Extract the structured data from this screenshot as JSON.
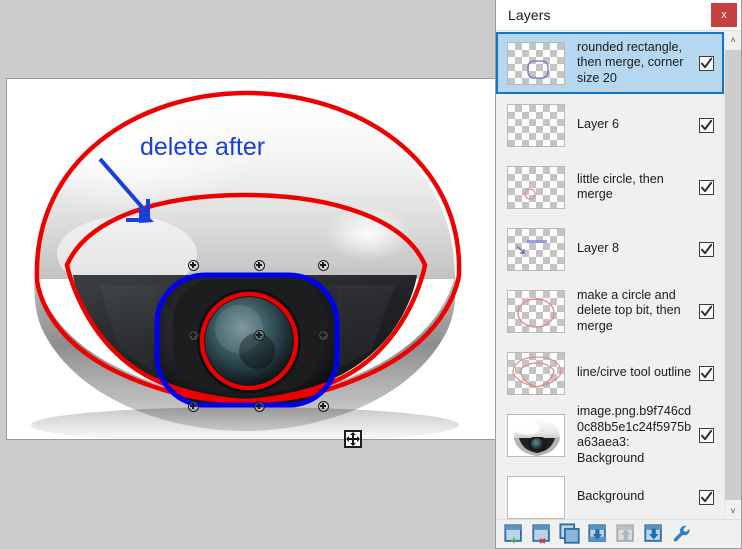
{
  "window": {
    "title": "Layers",
    "close_label": "x",
    "close_icon": "close-icon"
  },
  "layers": {
    "checkbox_icon": "checkmark-icon",
    "items": [
      {
        "name": "rounded rectangle, then merge, corner size 20",
        "visible": true,
        "selected": true,
        "thumb": "checker-rounded-rect"
      },
      {
        "name": "Layer 6",
        "visible": true,
        "selected": false,
        "thumb": "checker-empty"
      },
      {
        "name": "little circle, then merge",
        "visible": true,
        "selected": false,
        "thumb": "checker-little-circle"
      },
      {
        "name": "Layer 8",
        "visible": true,
        "selected": false,
        "thumb": "checker-arrow-text"
      },
      {
        "name": "make a circle and delete top bit, then merge",
        "visible": true,
        "selected": false,
        "thumb": "checker-circle"
      },
      {
        "name": "line/cirve tool outline",
        "visible": true,
        "selected": false,
        "thumb": "checker-dome-outline"
      },
      {
        "name": "image.png.b9f746cd0c88b5e1c24f5975ba63aea3: Background",
        "visible": true,
        "selected": false,
        "thumb": "camera-photo"
      },
      {
        "name": "Background",
        "visible": true,
        "selected": false,
        "thumb": "white-empty"
      }
    ]
  },
  "scrollbar": {
    "up_arrow": "˄",
    "down_arrow": "˅"
  },
  "toolbar": {
    "buttons": [
      {
        "label": "New Layer",
        "icon": "new-layer-icon"
      },
      {
        "label": "Delete Layer",
        "icon": "delete-layer-icon"
      },
      {
        "label": "Duplicate Layer",
        "icon": "duplicate-layer-icon"
      },
      {
        "label": "Merge Layer Down",
        "icon": "merge-layer-down-icon"
      },
      {
        "label": "Move Layer Up",
        "icon": "move-layer-up-icon"
      },
      {
        "label": "Move Layer Down",
        "icon": "move-layer-down-icon"
      },
      {
        "label": "Layer Properties",
        "icon": "layer-properties-icon"
      }
    ]
  },
  "canvas": {
    "annotation_text": "delete after",
    "annotation_color": "#1a3fd8",
    "outline_color": "#ee0000",
    "selection_color": "#0000ee",
    "move_cursor_icon": "move-cursor-icon"
  }
}
